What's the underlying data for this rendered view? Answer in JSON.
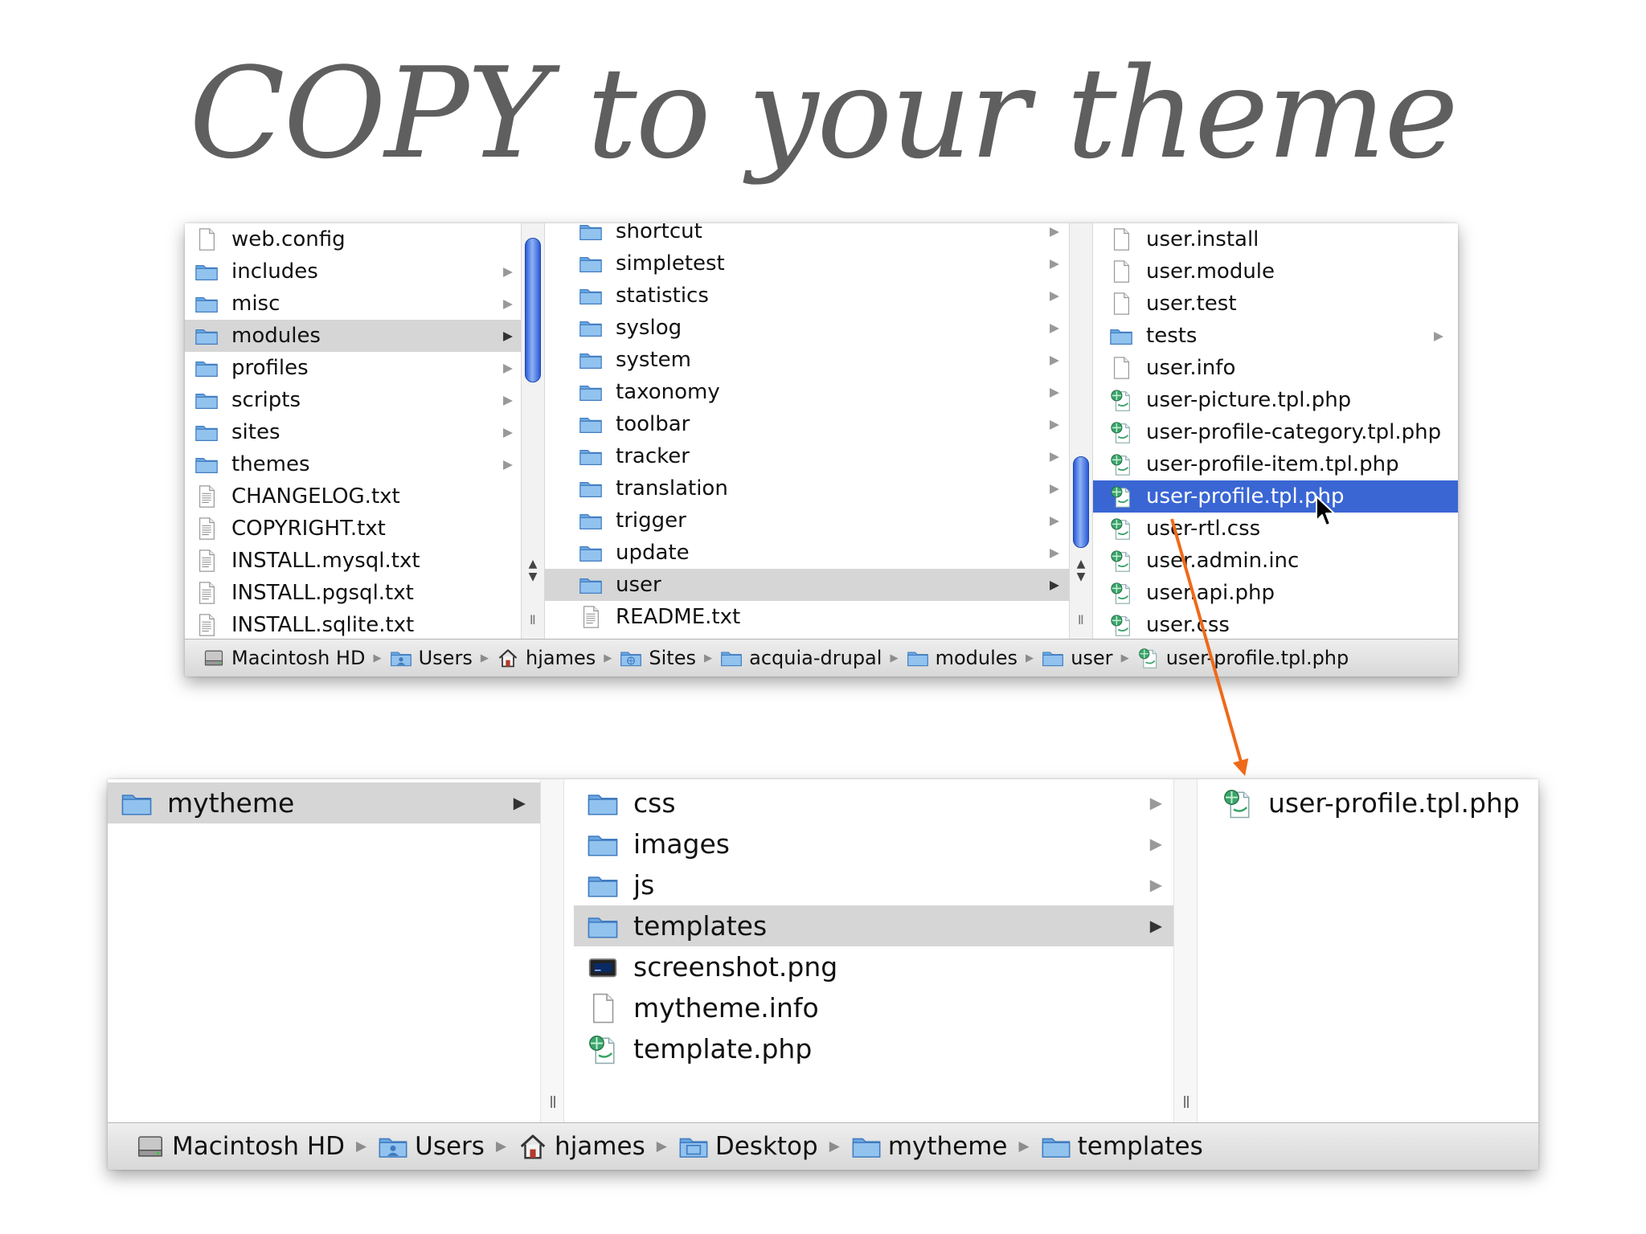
{
  "slide": {
    "title": "COPY to your theme"
  },
  "top_window": {
    "col1": {
      "items": [
        {
          "label": "web.config",
          "icon": "document-icon",
          "arrow": false,
          "selected": false
        },
        {
          "label": "includes",
          "icon": "folder-icon",
          "arrow": true,
          "selected": false
        },
        {
          "label": "misc",
          "icon": "folder-icon",
          "arrow": true,
          "selected": false
        },
        {
          "label": "modules",
          "icon": "folder-icon",
          "arrow": true,
          "selected": true
        },
        {
          "label": "profiles",
          "icon": "folder-icon",
          "arrow": true,
          "selected": false
        },
        {
          "label": "scripts",
          "icon": "folder-icon",
          "arrow": true,
          "selected": false
        },
        {
          "label": "sites",
          "icon": "folder-icon",
          "arrow": true,
          "selected": false
        },
        {
          "label": "themes",
          "icon": "folder-icon",
          "arrow": true,
          "selected": false
        },
        {
          "label": "CHANGELOG.txt",
          "icon": "text-file-icon",
          "arrow": false,
          "selected": false
        },
        {
          "label": "COPYRIGHT.txt",
          "icon": "text-file-icon",
          "arrow": false,
          "selected": false
        },
        {
          "label": "INSTALL.mysql.txt",
          "icon": "text-file-icon",
          "arrow": false,
          "selected": false
        },
        {
          "label": "INSTALL.pgsql.txt",
          "icon": "text-file-icon",
          "arrow": false,
          "selected": false
        },
        {
          "label": "INSTALL.sqlite.txt",
          "icon": "text-file-icon",
          "arrow": false,
          "selected": false
        }
      ]
    },
    "col2": {
      "items": [
        {
          "label": "shortcut",
          "icon": "folder-icon",
          "arrow": true,
          "selected": false
        },
        {
          "label": "simpletest",
          "icon": "folder-icon",
          "arrow": true,
          "selected": false
        },
        {
          "label": "statistics",
          "icon": "folder-icon",
          "arrow": true,
          "selected": false
        },
        {
          "label": "syslog",
          "icon": "folder-icon",
          "arrow": true,
          "selected": false
        },
        {
          "label": "system",
          "icon": "folder-icon",
          "arrow": true,
          "selected": false
        },
        {
          "label": "taxonomy",
          "icon": "folder-icon",
          "arrow": true,
          "selected": false
        },
        {
          "label": "toolbar",
          "icon": "folder-icon",
          "arrow": true,
          "selected": false
        },
        {
          "label": "tracker",
          "icon": "folder-icon",
          "arrow": true,
          "selected": false
        },
        {
          "label": "translation",
          "icon": "folder-icon",
          "arrow": true,
          "selected": false
        },
        {
          "label": "trigger",
          "icon": "folder-icon",
          "arrow": true,
          "selected": false
        },
        {
          "label": "update",
          "icon": "folder-icon",
          "arrow": true,
          "selected": false
        },
        {
          "label": "user",
          "icon": "folder-icon",
          "arrow": true,
          "selected": true
        },
        {
          "label": "README.txt",
          "icon": "text-file-icon",
          "arrow": false,
          "selected": false
        }
      ]
    },
    "col3": {
      "items": [
        {
          "label": "user.install",
          "icon": "document-icon",
          "arrow": false,
          "selected": false
        },
        {
          "label": "user.module",
          "icon": "document-icon",
          "arrow": false,
          "selected": false
        },
        {
          "label": "user.test",
          "icon": "document-icon",
          "arrow": false,
          "selected": false
        },
        {
          "label": "tests",
          "icon": "folder-icon",
          "arrow": true,
          "selected": false
        },
        {
          "label": "user.info",
          "icon": "document-icon",
          "arrow": false,
          "selected": false
        },
        {
          "label": "user-picture.tpl.php",
          "icon": "php-file-icon",
          "arrow": false,
          "selected": false
        },
        {
          "label": "user-profile-category.tpl.php",
          "icon": "php-file-icon",
          "arrow": false,
          "selected": false
        },
        {
          "label": "user-profile-item.tpl.php",
          "icon": "php-file-icon",
          "arrow": false,
          "selected": false
        },
        {
          "label": "user-profile.tpl.php",
          "icon": "php-file-icon",
          "arrow": false,
          "selected": true
        },
        {
          "label": "user-rtl.css",
          "icon": "php-file-icon",
          "arrow": false,
          "selected": false
        },
        {
          "label": "user.admin.inc",
          "icon": "php-file-icon",
          "arrow": false,
          "selected": false
        },
        {
          "label": "user.api.php",
          "icon": "php-file-icon",
          "arrow": false,
          "selected": false
        },
        {
          "label": "user.css",
          "icon": "php-file-icon",
          "arrow": false,
          "selected": false
        }
      ]
    },
    "path": [
      {
        "label": "Macintosh HD",
        "icon": "hard-drive-icon"
      },
      {
        "label": "Users",
        "icon": "users-folder-icon"
      },
      {
        "label": "hjames",
        "icon": "home-icon"
      },
      {
        "label": "Sites",
        "icon": "sites-folder-icon"
      },
      {
        "label": "acquia-drupal",
        "icon": "folder-icon"
      },
      {
        "label": "modules",
        "icon": "folder-icon"
      },
      {
        "label": "user",
        "icon": "folder-icon"
      },
      {
        "label": "user-profile.tpl.php",
        "icon": "php-file-icon"
      }
    ]
  },
  "bottom_window": {
    "col1": {
      "items": [
        {
          "label": "mytheme",
          "icon": "folder-icon",
          "arrow": true,
          "selected": true
        }
      ]
    },
    "col2": {
      "items": [
        {
          "label": "css",
          "icon": "folder-icon",
          "arrow": true,
          "selected": false
        },
        {
          "label": "images",
          "icon": "folder-icon",
          "arrow": true,
          "selected": false
        },
        {
          "label": "js",
          "icon": "folder-icon",
          "arrow": true,
          "selected": false
        },
        {
          "label": "templates",
          "icon": "folder-icon",
          "arrow": true,
          "selected": true
        },
        {
          "label": "screenshot.png",
          "icon": "image-file-icon",
          "arrow": false,
          "selected": false
        },
        {
          "label": "mytheme.info",
          "icon": "document-icon",
          "arrow": false,
          "selected": false
        },
        {
          "label": "template.php",
          "icon": "php-file-icon",
          "arrow": false,
          "selected": false
        }
      ]
    },
    "col3": {
      "items": [
        {
          "label": "user-profile.tpl.php",
          "icon": "php-file-icon",
          "arrow": false,
          "selected": false
        }
      ]
    },
    "path": [
      {
        "label": "Macintosh HD",
        "icon": "hard-drive-icon"
      },
      {
        "label": "Users",
        "icon": "users-folder-icon"
      },
      {
        "label": "hjames",
        "icon": "home-icon"
      },
      {
        "label": "Desktop",
        "icon": "desktop-folder-icon"
      },
      {
        "label": "mytheme",
        "icon": "folder-icon"
      },
      {
        "label": "templates",
        "icon": "folder-icon"
      }
    ]
  },
  "colors": {
    "selection_blue": "#3a66d4",
    "selection_gray": "#d6d6d6",
    "folder_blue": "#7fb3e6",
    "arrow_orange": "#ee6a1a",
    "title_gray": "#5f5f5f"
  }
}
